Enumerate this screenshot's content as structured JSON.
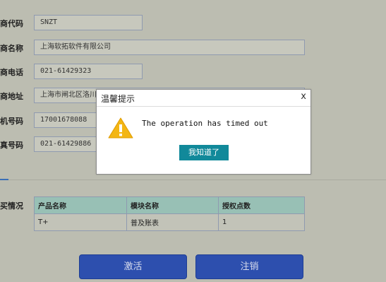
{
  "form": {
    "rows": [
      {
        "label": "商代码",
        "value": "SNZT"
      },
      {
        "label": "商名称",
        "value": "上海软拓软件有限公司"
      },
      {
        "label": "商电话",
        "value": "021-61429323"
      },
      {
        "label": "商地址",
        "value": "上海市闸北区洛川中"
      },
      {
        "label": "机号码",
        "value": "17001678088"
      },
      {
        "label": "真号码",
        "value": "021-61429886"
      }
    ]
  },
  "section": {
    "label": "买情况"
  },
  "table": {
    "headers": [
      "产品名称",
      "模块名称",
      "授权点数"
    ],
    "rows": [
      [
        "T+",
        "普及账表",
        "1"
      ]
    ]
  },
  "buttons": {
    "activate": "激活",
    "cancel": "注销"
  },
  "dialog": {
    "title": "温馨提示",
    "close": "x",
    "message": "The operation has timed out",
    "confirm": "我知道了"
  }
}
